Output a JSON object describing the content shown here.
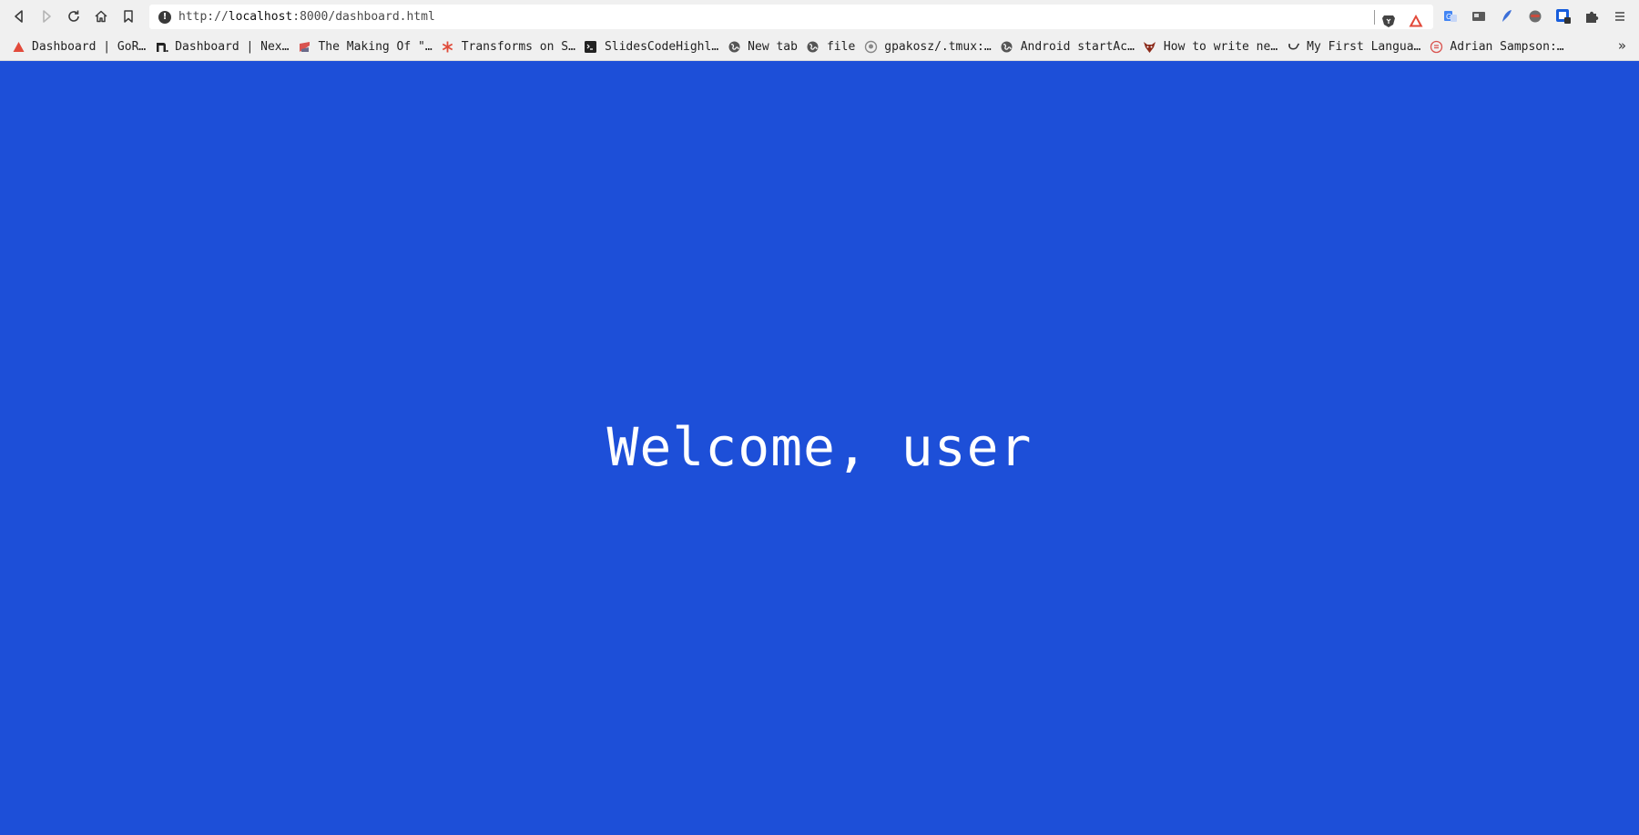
{
  "toolbar": {
    "url_scheme": "http://",
    "url_host": "localhost",
    "url_rest": ":8000/dashboard.html",
    "back_icon": "back-arrow-icon",
    "forward_icon": "forward-arrow-icon",
    "reload_icon": "reload-icon",
    "home_icon": "home-icon",
    "bookmark_icon": "bookmark-icon"
  },
  "bookmarks": [
    {
      "label": "Dashboard | GoR…",
      "icon": "triangle-logo-icon",
      "color": "#e24a3b"
    },
    {
      "label": "Dashboard | Nex…",
      "icon": "n-logo-icon",
      "color": "#222222"
    },
    {
      "label": "The Making Of \"…",
      "icon": "s-logo-icon",
      "color": "#d9534f"
    },
    {
      "label": "Transforms on S…",
      "icon": "asterisk-icon",
      "color": "#e04b3a"
    },
    {
      "label": "SlidesCodeHighl…",
      "icon": "code-box-icon",
      "color": "#222222"
    },
    {
      "label": "New tab",
      "icon": "globe-icon",
      "color": "#555555"
    },
    {
      "label": "file",
      "icon": "globe-icon",
      "color": "#555555"
    },
    {
      "label": "gpakosz/.tmux:…",
      "icon": "github-icon",
      "color": "#555555"
    },
    {
      "label": "Android startAc…",
      "icon": "globe-icon",
      "color": "#555555"
    },
    {
      "label": "How to write ne…",
      "icon": "bull-logo-icon",
      "color": "#8b2a1a"
    },
    {
      "label": "My First Langua…",
      "icon": "hook-icon",
      "color": "#333333"
    },
    {
      "label": "Adrian Sampson:…",
      "icon": "circle-logo-icon",
      "color": "#d9534f"
    }
  ],
  "bookmarks_overflow": "»",
  "content": {
    "welcome": "Welcome, user",
    "background": "#1d4fd8"
  }
}
